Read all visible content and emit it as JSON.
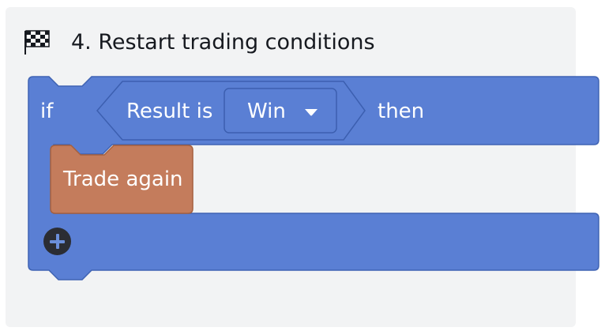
{
  "panel": {
    "title": "4. Restart trading conditions",
    "icon": "checkered-flag-icon"
  },
  "if_block": {
    "if_label": "if",
    "then_label": "then",
    "color": "#5a7fd4",
    "condition": {
      "label": "Result is",
      "selected_value": "Win"
    }
  },
  "action_block": {
    "label": "Trade again",
    "color": "#c47c5c"
  },
  "add_button": {
    "icon": "plus-icon"
  }
}
